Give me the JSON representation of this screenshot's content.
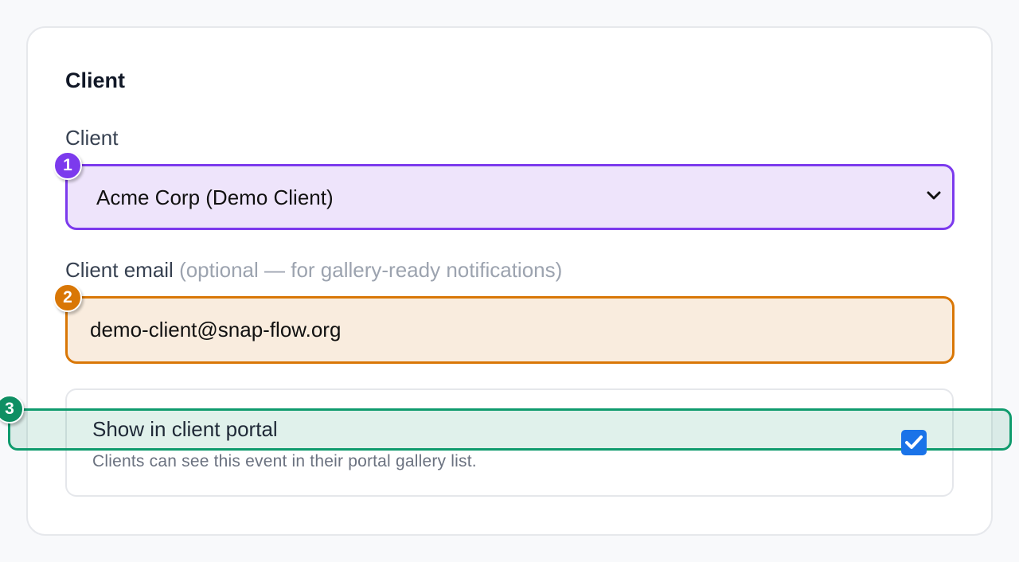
{
  "section": {
    "title": "Client"
  },
  "client_field": {
    "label": "Client",
    "selected_value": "Acme Corp (Demo Client)"
  },
  "email_field": {
    "label": "Client email",
    "hint": "(optional — for gallery-ready notifications)",
    "value": "demo-client@snap-flow.org"
  },
  "portal_option": {
    "title": "Show in client portal",
    "description": "Clients can see this event in their portal gallery list.",
    "checked": true
  },
  "annotations": {
    "badge_1": "1",
    "badge_2": "2",
    "badge_3": "3"
  },
  "colors": {
    "select_accent": "#7c3aed",
    "email_accent": "#d97706",
    "option_accent": "#0f9b6d",
    "checkbox": "#1a73e8"
  }
}
